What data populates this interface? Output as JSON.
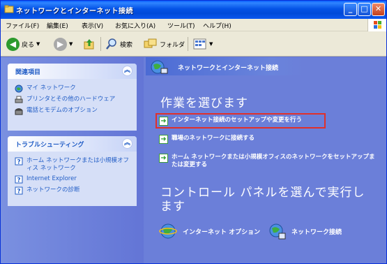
{
  "window": {
    "title": "ネットワークとインターネット接続",
    "min": "_",
    "max": "□",
    "close": "✕"
  },
  "menu": [
    "ファイル(F)",
    "編集(E)",
    "表示(V)",
    "お気に入り(A)",
    "ツール(T)",
    "ヘルプ(H)"
  ],
  "toolbar": {
    "back_label": "戻る",
    "search_label": "検索",
    "folder_label": "フォルダ"
  },
  "sidebar": {
    "related": {
      "title": "関連項目",
      "items": [
        "マイ ネットワーク",
        "プリンタとその他のハードウェア",
        "電話とモデムのオプション"
      ]
    },
    "troubleshoot": {
      "title": "トラブルシューティング",
      "items": [
        "ホーム ネットワークまたは小規模オフィス ネットワーク",
        "Internet Explorer",
        "ネットワークの診断"
      ]
    }
  },
  "content": {
    "header": "ネットワークとインターネット接続",
    "choose_task": "作業を選びます",
    "tasks": [
      "インターネット接続のセットアップや変更を行う",
      "職場のネットワークに接続する",
      "ホーム ネットワークまたは小規模オフィスのネットワークをセットアップまたは変更する"
    ],
    "pick_panel": "コントロール パネルを選んで実行します",
    "panels": [
      "インターネット オプション",
      "ネットワーク接続"
    ]
  }
}
